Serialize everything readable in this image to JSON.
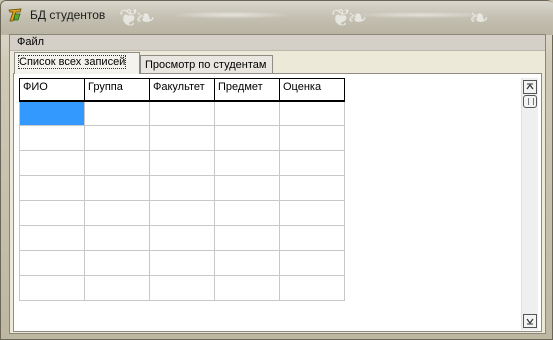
{
  "window": {
    "title": "БД студентов",
    "icon": "app-logo-icon"
  },
  "menu": {
    "file_label": "Файл"
  },
  "tabs": [
    {
      "label": "Список всех записей",
      "active": true
    },
    {
      "label": "Просмотр по студентам",
      "active": false
    }
  ],
  "grid": {
    "columns": [
      "ФИО",
      "Группа",
      "Факультет",
      "Предмет",
      "Оценка"
    ],
    "empty_rows": 8,
    "selected_cell": {
      "row": 0,
      "col": 0
    },
    "selection_color": "#3399ff"
  },
  "scrollbar": {
    "up_icon": "arrow-up-icon",
    "down_icon": "arrow-down-icon"
  }
}
